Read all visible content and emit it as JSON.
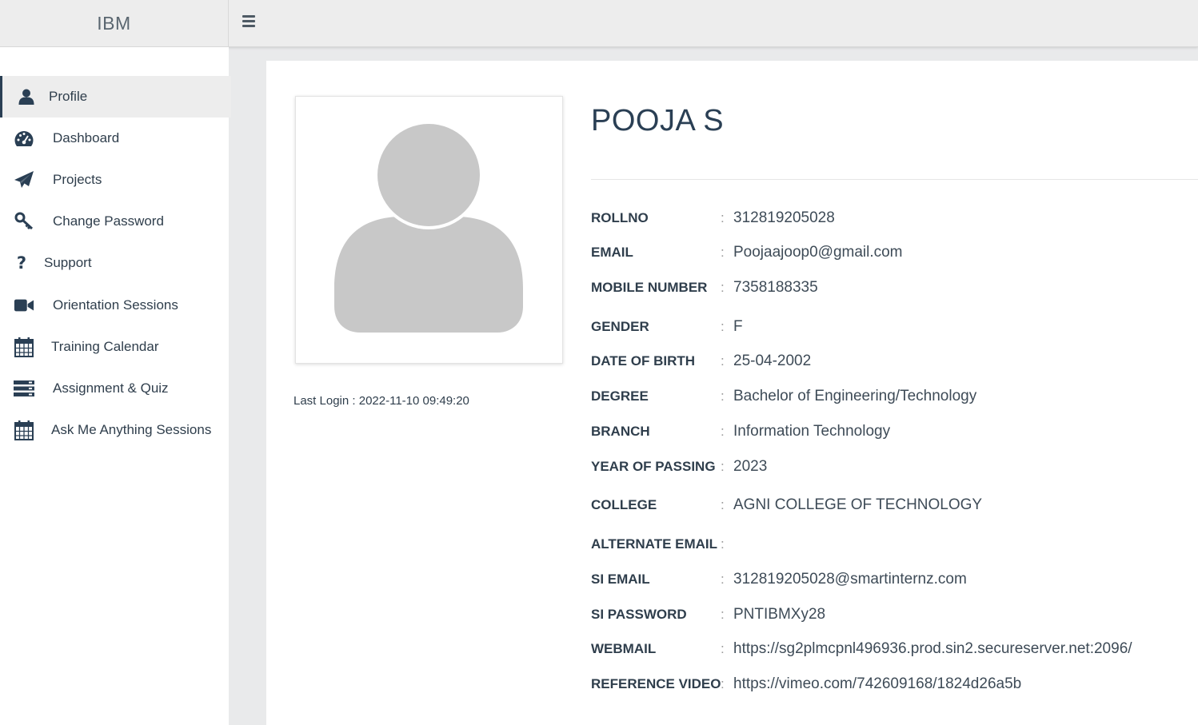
{
  "header": {
    "brand": "IBM",
    "menu_icon": "hamburger-menu-icon"
  },
  "sidebar": {
    "items": [
      {
        "label": "Profile",
        "icon": "user-icon"
      },
      {
        "label": "Dashboard",
        "icon": "dashboard-icon"
      },
      {
        "label": "Projects",
        "icon": "paper-plane-icon"
      },
      {
        "label": "Change Password",
        "icon": "key-icon"
      },
      {
        "label": "Support",
        "icon": "question-icon"
      },
      {
        "label": "Orientation Sessions",
        "icon": "video-camera-icon"
      },
      {
        "label": "Training Calendar",
        "icon": "calendar-icon"
      },
      {
        "label": "Assignment & Quiz",
        "icon": "server-list-icon"
      },
      {
        "label": "Ask Me Anything Sessions",
        "icon": "calendar-icon"
      }
    ]
  },
  "profile": {
    "name": "POOJA S",
    "last_login": "Last Login : 2022-11-10 09:49:20",
    "separator": ":",
    "fields": [
      {
        "label": "ROLLNO",
        "value": "312819205028"
      },
      {
        "label": "EMAIL",
        "value": "Poojaajoop0@gmail.com"
      },
      {
        "label": "MOBILE NUMBER",
        "value": "7358188335"
      },
      {
        "label": "GENDER",
        "value": "F"
      },
      {
        "label": "DATE OF BIRTH",
        "value": "25-04-2002"
      },
      {
        "label": "DEGREE",
        "value": "Bachelor of Engineering/Technology"
      },
      {
        "label": "BRANCH",
        "value": "Information Technology"
      },
      {
        "label": "YEAR OF PASSING",
        "value": "2023"
      },
      {
        "label": "COLLEGE",
        "value": "AGNI COLLEGE OF TECHNOLOGY"
      },
      {
        "label": "ALTERNATE EMAIL",
        "value": ""
      },
      {
        "label": "SI EMAIL",
        "value": "312819205028@smartinternz.com"
      },
      {
        "label": "SI PASSWORD",
        "value": "PNTIBMXy28"
      },
      {
        "label": "WEBMAIL",
        "value": "https://sg2plmcpnl496936.prod.sin2.secureserver.net:2096/"
      },
      {
        "label": "REFERENCE VIDEO",
        "value": "https://vimeo.com/742609168/1824d26a5b"
      }
    ]
  },
  "colors": {
    "primary_text": "#2a3f54",
    "topbar": "#ededed",
    "active_nav": "#ededed",
    "avatar_placeholder": "#c8c8c8"
  }
}
